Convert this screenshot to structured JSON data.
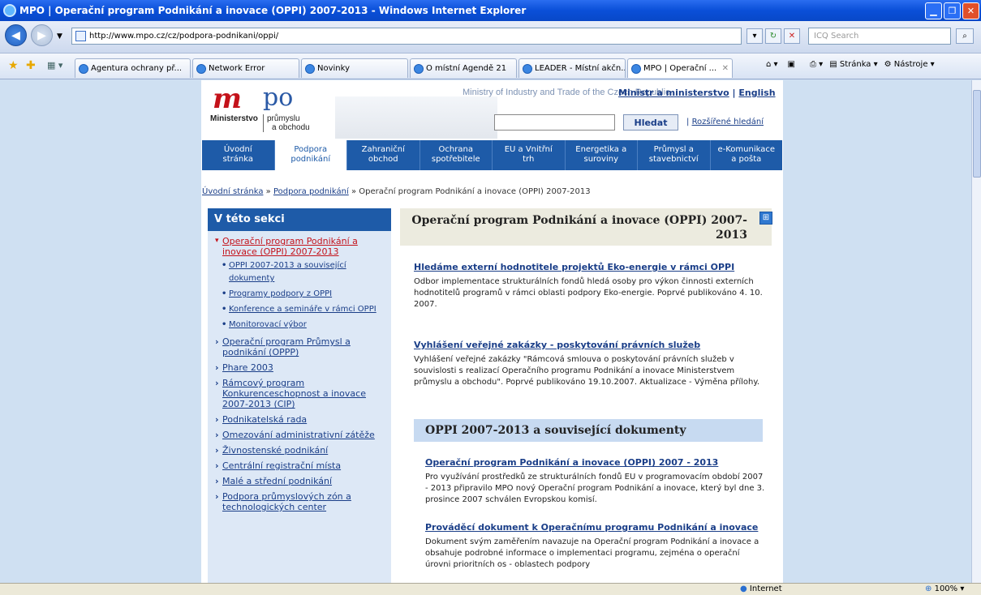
{
  "window": {
    "title": "MPO | Operační program Podnikání a inovace (OPPI) 2007-2013 - Windows Internet Explorer"
  },
  "address": {
    "url": "http://www.mpo.cz/cz/podpora-podnikani/oppi/",
    "search_placeholder": "ICQ Search"
  },
  "tabs": [
    {
      "label": "Agentura ochrany př..."
    },
    {
      "label": "Network Error"
    },
    {
      "label": "Novinky"
    },
    {
      "label": "O místní Agendě 21"
    },
    {
      "label": "LEADER - Místní akčn..."
    },
    {
      "label": "MPO | Operační ..."
    }
  ],
  "toolbar": {
    "page": "Stránka",
    "tools": "Nástroje"
  },
  "site": {
    "logo_m": "m",
    "logo_po": "po",
    "logo_line1": "Ministerstvo",
    "logo_line2": "průmyslu",
    "logo_line3": "a obchodu",
    "ministry_en": "Ministry of Industry and Trade of the Czech Republic",
    "link_minister": "Ministr a ministerstvo",
    "link_sep": "|",
    "link_english": "English",
    "search_button": "Hledat",
    "adv_search": "Rozšířené hledání"
  },
  "nav": [
    {
      "l1": "Úvodní",
      "l2": "stránka"
    },
    {
      "l1": "Podpora",
      "l2": "podnikání"
    },
    {
      "l1": "Zahraniční",
      "l2": "obchod"
    },
    {
      "l1": "Ochrana",
      "l2": "spotřebitele"
    },
    {
      "l1": "EU a Vnitřní",
      "l2": "trh"
    },
    {
      "l1": "Energetika a",
      "l2": "suroviny"
    },
    {
      "l1": "Průmysl a",
      "l2": "stavebnictví"
    },
    {
      "l1": "e-Komunikace",
      "l2": "a pošta"
    }
  ],
  "breadcrumb": {
    "home": "Úvodní stránka",
    "sep": "»",
    "section": "Podpora podnikání",
    "current": "Operační program Podnikání a inovace (OPPI) 2007-2013"
  },
  "sidebar": {
    "heading": "V této sekci",
    "items": [
      {
        "label": "Operační program Podnikání a inovace (OPPI) 2007-2013"
      },
      {
        "label": "OPPI 2007-2013 a související dokumenty"
      },
      {
        "label": "Programy podpory z OPPI"
      },
      {
        "label": "Konference a semináře v rámci OPPI"
      },
      {
        "label": "Monitorovací výbor"
      },
      {
        "label": "Operační program Průmysl a podnikání (OPPP)"
      },
      {
        "label": "Phare 2003"
      },
      {
        "label": "Rámcový program Konkurenceschopnost a inovace 2007-2013 (CIP)"
      },
      {
        "label": "Podnikatelská rada"
      },
      {
        "label": "Omezování administrativní zátěže"
      },
      {
        "label": "Živnostenské podnikání"
      },
      {
        "label": "Centrální registrační místa"
      },
      {
        "label": "Malé a střední podnikání"
      },
      {
        "label": "Podpora průmyslových zón a technologických center"
      }
    ]
  },
  "content": {
    "title": "Operační program Podnikání a inovace (OPPI) 2007-2013",
    "news": [
      {
        "title": "Hledáme externí hodnotitele projektů Eko-energie v rámci OPPI",
        "text": "Odbor implementace strukturálních fondů hledá osoby pro výkon činnosti externích hodnotitelů programů v rámci oblasti podpory Eko-energie. Poprvé publikováno 4. 10. 2007."
      },
      {
        "title": "Vyhlášení veřejné zakázky - poskytování právních služeb",
        "text": "Vyhlášení veřejné zakázky \"Rámcová smlouva o poskytování právních služeb v souvislosti s realizací Operačního programu Podnikání a inovace Ministerstvem průmyslu a obchodu\". Poprvé publikováno 19.10.2007. Aktualizace - Výměna přílohy."
      }
    ],
    "section2_title": "OPPI 2007-2013 a související dokumenty",
    "docs": [
      {
        "title": "Operační program Podnikání a inovace (OPPI) 2007 - 2013",
        "text": "Pro využívání prostředků ze strukturálních fondů EU v programovacím období 2007 - 2013 připravilo MPO nový Operační program Podnikání a inovace, který byl dne 3. prosince 2007 schválen Evropskou komisí."
      },
      {
        "title": "Prováděcí dokument k Operačnímu programu Podnikání a inovace",
        "text": "Dokument svým zaměřením navazuje na Operační program Podnikání a inovace a obsahuje podrobné informace o implementaci programu, zejména o operační úrovni prioritních os - oblastech podpory"
      }
    ]
  },
  "status": {
    "zone": "Internet",
    "zoom": "100%"
  }
}
